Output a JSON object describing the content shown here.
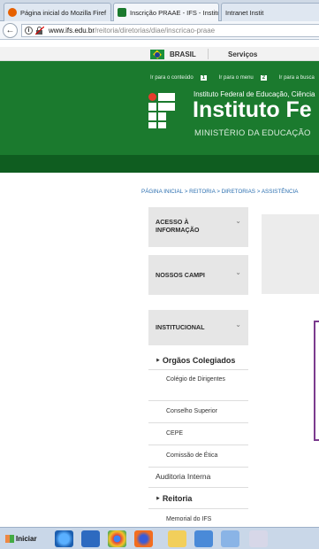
{
  "browser": {
    "tabs": [
      {
        "label": "Página inicial do Mozilla Firef",
        "close": "×",
        "icon_color": "#e66000"
      },
      {
        "label": "Inscrição PRAAE - IFS - Institu",
        "close": "×",
        "icon_color": "#1b7a2e"
      },
      {
        "label": "Intranet Instit",
        "close": "",
        "icon_color": ""
      }
    ],
    "back_icon": "arrow-left-icon",
    "url_host": "www.ifs.edu.br",
    "url_path": "/reitoria/diretorias/diae/inscricao-praae"
  },
  "gov_bar": {
    "brasil": "BRASIL",
    "servicos": "Serviços"
  },
  "header": {
    "access_links": [
      {
        "label": "Ir para o conteúdo",
        "key": "1"
      },
      {
        "label": "Ir para o menu",
        "key": "2"
      },
      {
        "label": "Ir para a busca",
        "key": ""
      }
    ],
    "inst_line": "Instituto Federal de Educação, Ciência",
    "title": "Instituto Fe",
    "ministerio": "MINISTÉRIO DA EDUCAÇÃO"
  },
  "breadcrumb": "PÁGINA INICIAL > REITORIA > DIRETORIAS > ASSISTÊNCIA",
  "sidebar": {
    "acesso": "ACESSO À INFORMAÇÃO",
    "campi": "NOSSOS CAMPI",
    "institucional": "INSTITUCIONAL",
    "orgaos": "Orgãos Colegiados",
    "orgaos_items": [
      "Colégio de Dirigentes",
      "Conselho Superior",
      "CEPE",
      "Comissão de Ética"
    ],
    "auditoria": "Auditoria Interna",
    "reitoria": "Reitoria",
    "reitoria_items": [
      "Memorial do IFS"
    ]
  },
  "taskbar": {
    "start": "Iniciar"
  },
  "colors": {
    "green_header": "#1b7a2e",
    "dark_band": "#0f5d20",
    "link_blue": "#2b6fb0",
    "box_purple": "#7b3b8e"
  }
}
